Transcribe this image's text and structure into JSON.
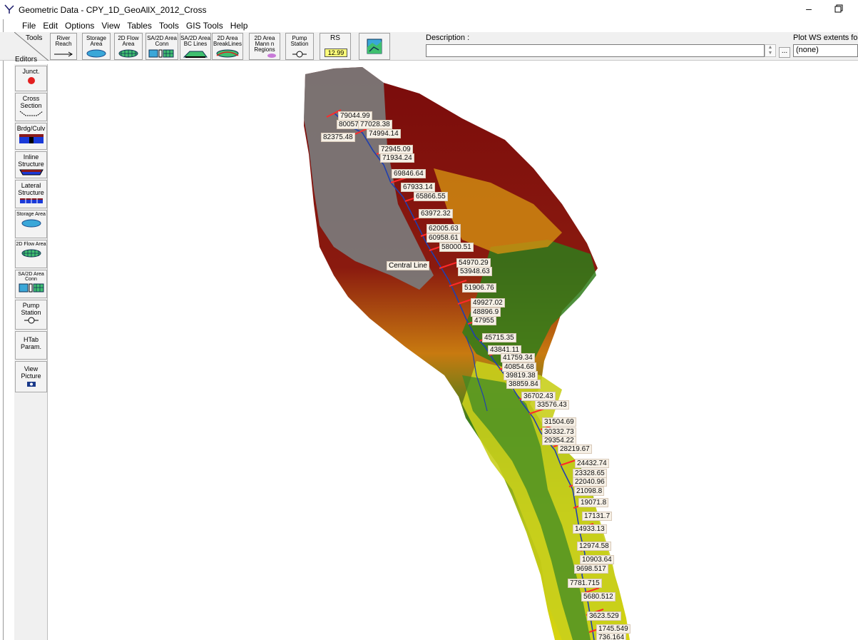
{
  "window": {
    "title": "Geometric Data - CPY_1D_GeoAllX_2012_Cross",
    "minimize_glyph": "–"
  },
  "menu": [
    "File",
    "Edit",
    "Options",
    "View",
    "Tables",
    "Tools",
    "GIS Tools",
    "Help"
  ],
  "toolbar": {
    "tools_label": "Tools",
    "editors_label": "Editors",
    "buttons": [
      {
        "label": "River Reach"
      },
      {
        "label": "Storage Area"
      },
      {
        "label": "2D Flow Area"
      },
      {
        "label": "SA/2D Area Conn"
      },
      {
        "label": "SA/2D Area BC Lines"
      },
      {
        "label": "2D Area BreakLines"
      },
      {
        "label": "2D Area Mann n Regions"
      },
      {
        "label": "Pump Station"
      },
      {
        "label": "RS",
        "value": "12.99"
      },
      {
        "label": ""
      }
    ],
    "description_label": "Description :",
    "description_value": "",
    "description_more": "...",
    "plot_ws_label": "Plot WS extents for",
    "plot_ws_value": "(none)"
  },
  "editors": [
    {
      "label": "Junct."
    },
    {
      "label": "Cross Section"
    },
    {
      "label": "Brdg/Culv"
    },
    {
      "label": "Inline Structure"
    },
    {
      "label": "Lateral Structure"
    },
    {
      "label": "Storage Area"
    },
    {
      "label": "2D Flow Area"
    },
    {
      "label": "SA/2D Area Conn"
    },
    {
      "label": "Pump Station"
    },
    {
      "label": "HTab Param."
    },
    {
      "label": "View Picture"
    }
  ],
  "map": {
    "reach_name": "Central Line",
    "colors": {
      "dem_high": "#7a0b0b",
      "dem_mid": "#e0a000",
      "dem_low": "#2f7d1a",
      "dem_lowest": "#d8d800",
      "dem_nodata": "#7b7b7b",
      "cross_section": "#ff2a2a",
      "river": "#1f3fb0"
    },
    "river_stations": [
      "79044.99",
      "80057",
      "77028.38",
      "82375.48",
      "74994.14",
      "72945.09",
      "71934.24",
      "69846.64",
      "67933.14",
      "65866.55",
      "63972.32",
      "62005.63",
      "60958.61",
      "58000.51",
      "54970.29",
      "53948.63",
      "51906.76",
      "49927.02",
      "48896.9",
      "47955",
      "45715.35",
      "43841.11",
      "41759.34",
      "40854.68",
      "39819.38",
      "38859.84",
      "36702.43",
      "33576.43",
      "31504.69",
      "30332.73",
      "29354.22",
      "28219.67",
      "24432.74",
      "23328.65",
      "22040.96",
      "21098.8",
      "19071.8",
      "17131.7",
      "14933.13",
      "12974.58",
      "10903.64",
      "9698.517",
      "7781.715",
      "5680.512",
      "3623.529",
      "1745.549",
      "736.164"
    ]
  }
}
